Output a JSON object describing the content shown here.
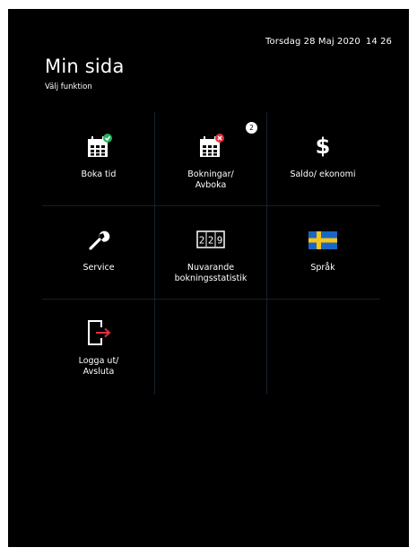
{
  "header": {
    "date": "Torsdag 28 Maj 2020",
    "time": "14 26",
    "title": "Min sida",
    "subtitle": "Välj funktion"
  },
  "tiles": [
    {
      "label": "Boka tid",
      "icon": "calendar-check-icon"
    },
    {
      "label": "Bokningar/\nAvboka",
      "icon": "calendar-cancel-icon",
      "badge": "2"
    },
    {
      "label": "Saldo/ ekonomi",
      "icon": "dollar-icon",
      "glyph": "$"
    },
    {
      "label": "Service",
      "icon": "wrench-icon"
    },
    {
      "label": "Nuvarande\nbokningsstatistik",
      "icon": "counter-icon",
      "counter": "229"
    },
    {
      "label": "Språk",
      "icon": "swedish-flag-icon"
    },
    {
      "label": "Logga ut/\nAvsluta",
      "icon": "logout-icon"
    }
  ],
  "colors": {
    "background": "#000000",
    "text": "#ffffff",
    "accent_green": "#22b35a",
    "accent_red": "#e0303a",
    "flag_blue": "#1a66c2",
    "flag_yellow": "#f5c518"
  }
}
